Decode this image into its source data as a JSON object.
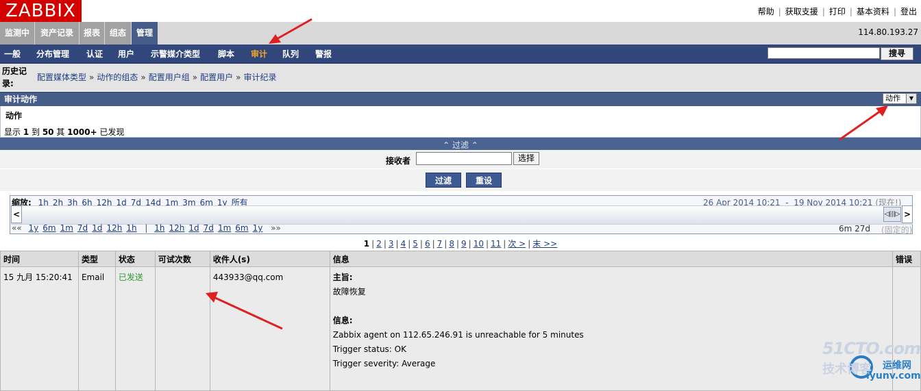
{
  "header": {
    "logo": "ZABBIX",
    "top_links": [
      "帮助",
      "获取支援",
      "打印",
      "基本资料",
      "登出"
    ],
    "ip": "114.80.193.27"
  },
  "main_menu": [
    "监测中",
    "资产记录",
    "报表",
    "组态",
    "管理"
  ],
  "main_menu_active": "管理",
  "sub_menu": [
    "一般",
    "分布管理",
    "认证",
    "用户",
    "示警媒介类型",
    "脚本",
    "审计",
    "队列",
    "警报"
  ],
  "sub_menu_active": "审计",
  "search": {
    "button": "搜寻",
    "value": ""
  },
  "history": {
    "label": "历史记录:",
    "items": [
      "配置媒体类型",
      "动作的组态",
      "配置用户组",
      "配置用户",
      "审计纪录"
    ]
  },
  "audit": {
    "title": "审计动作",
    "select_value": "动作",
    "section": "动作",
    "showing": {
      "prefix": "显示 ",
      "from": "1",
      "to_word": " 到 ",
      "to": "50",
      "of_word": " 其 ",
      "total": "1000+",
      "suffix": " 已发现"
    }
  },
  "filter": {
    "toggle": "⌃ 过滤 ⌃",
    "recipient_label": "接收者",
    "recipient_value": "",
    "select_button": "选择",
    "filter_button": "过滤",
    "reset_button": "重设"
  },
  "timeline": {
    "zoom_label": "缩放:",
    "zoom": [
      "1h",
      "2h",
      "3h",
      "6h",
      "12h",
      "1d",
      "7d",
      "14d",
      "1m",
      "3m",
      "6m",
      "1y",
      "所有"
    ],
    "range_from": "26 Apr 2014 10:21",
    "range_sep": "-",
    "range_to": "19 Nov 2014 10:21",
    "now": "(现在!)",
    "back_arrows": "««",
    "back": [
      "1y",
      "6m",
      "1m",
      "7d",
      "1d",
      "12h",
      "1h"
    ],
    "sep": "|",
    "fwd": [
      "1h",
      "12h",
      "1d",
      "7d",
      "1m",
      "6m",
      "1y"
    ],
    "fwd_arrows": "»»",
    "period": "6m 27d",
    "fixed": "(固定的)"
  },
  "pager": {
    "pages": [
      "1",
      "2",
      "3",
      "4",
      "5",
      "6",
      "7",
      "8",
      "9",
      "10",
      "11"
    ],
    "current": "1",
    "next": "次 >",
    "last": "末 >>"
  },
  "table": {
    "headers": [
      "时间",
      "类型",
      "状态",
      "可试次数",
      "收件人(s)",
      "信息",
      "错误"
    ],
    "rows": [
      {
        "time": "15 九月 15:20:41",
        "type": "Email",
        "status": "已发送",
        "retries": "",
        "recipient": "443933@qq.com",
        "subject_label": "主旨:",
        "subject": "故障恢复",
        "message_label": "信息:",
        "message_lines": [
          "Zabbix agent on 112.65.246.91 is unreachable for 5 minutes",
          "Trigger status: OK",
          "Trigger severity: Average"
        ],
        "error": ""
      }
    ]
  },
  "watermark": {
    "line1": "51CTO.com",
    "line2": "技术博客",
    "line3": "运维网",
    "line4": "iyunv.com"
  },
  "colors": {
    "logo": "#d40000",
    "menu_active": "#465d8a",
    "submenu_bg": "#31477c",
    "submenu_active_text": "#f5a623",
    "status_ok": "#2e9b2e",
    "annotation_arrow": "#e02020"
  }
}
